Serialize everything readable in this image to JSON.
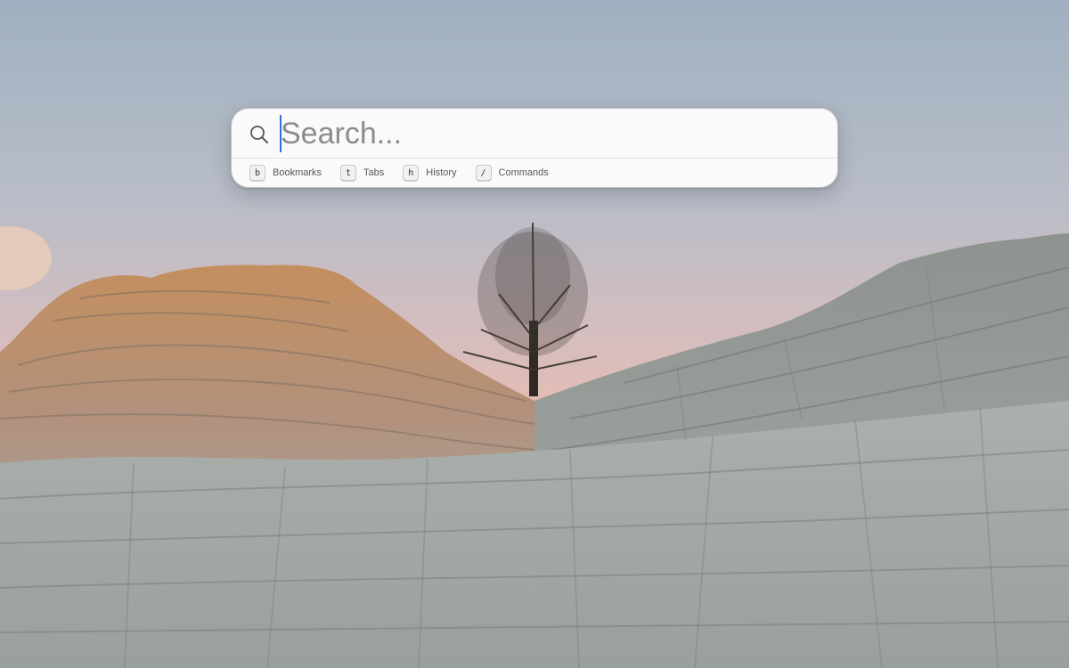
{
  "search": {
    "placeholder": "Search...",
    "value": ""
  },
  "shortcuts": [
    {
      "key": "b",
      "label": "Bookmarks"
    },
    {
      "key": "t",
      "label": "Tabs"
    },
    {
      "key": "h",
      "label": "History"
    },
    {
      "key": "/",
      "label": "Commands"
    }
  ],
  "colors": {
    "caret": "#2f6fe0",
    "sky_top": "#9fb0bf",
    "sky_bottom": "#e4bdb4",
    "rock": "#9fa6a2"
  },
  "icons": {
    "search": "magnifier-icon"
  }
}
